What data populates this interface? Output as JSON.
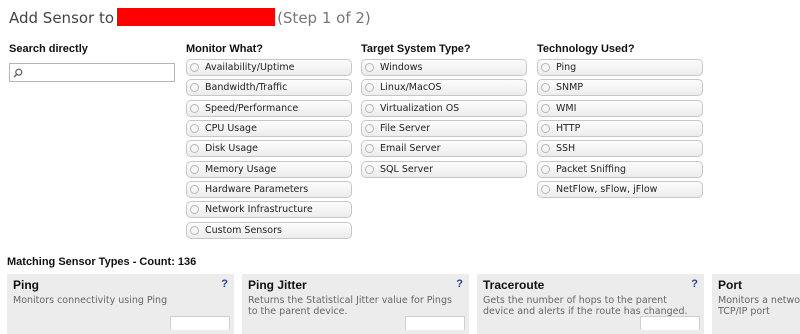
{
  "header": {
    "title_prefix": "Add Sensor to",
    "step": "(Step 1 of 2)"
  },
  "search": {
    "label": "Search directly",
    "value": "",
    "icon": "search-icon"
  },
  "monitor_what": {
    "label": "Monitor What?",
    "options": [
      "Availability/Uptime",
      "Bandwidth/Traffic",
      "Speed/Performance",
      "CPU Usage",
      "Disk Usage",
      "Memory Usage",
      "Hardware Parameters",
      "Network Infrastructure",
      "Custom Sensors"
    ]
  },
  "target_system": {
    "label": "Target System Type?",
    "options": [
      "Windows",
      "Linux/MacOS",
      "Virtualization OS",
      "File Server",
      "Email Server",
      "SQL Server"
    ]
  },
  "technology": {
    "label": "Technology Used?",
    "options": [
      "Ping",
      "SNMP",
      "WMI",
      "HTTP",
      "SSH",
      "Packet Sniffing",
      "NetFlow, sFlow, jFlow"
    ]
  },
  "matching": {
    "label": "Matching Sensor Types - Count: 136",
    "cards": [
      {
        "title": "Ping",
        "description": "Monitors connectivity using Ping",
        "help": "?"
      },
      {
        "title": "Ping Jitter",
        "description": "Returns the Statistical Jitter value for Pings to the parent device.",
        "help": "?"
      },
      {
        "title": "Traceroute",
        "description": "Gets the number of hops to the parent device and alerts if the route has changed.",
        "help": "?"
      },
      {
        "title": "Port",
        "description": "Monitors a network TCP/IP port",
        "help": "?"
      }
    ]
  },
  "colors": {
    "redaction": "#ff0000",
    "help_mark": "#2a3f8f",
    "card_bg": "#ececec"
  }
}
